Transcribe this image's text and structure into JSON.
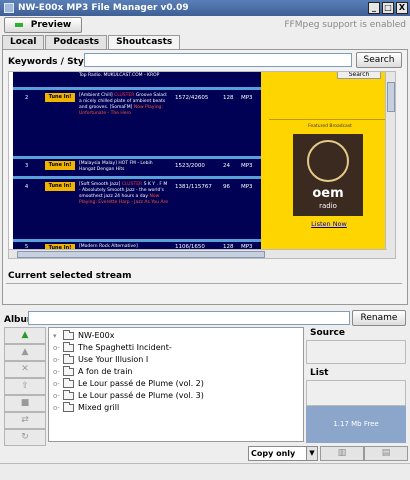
{
  "window": {
    "title": "NW-E00x MP3 File Manager v0.09",
    "controls": [
      "_",
      "□",
      "X"
    ]
  },
  "toolbar": {
    "preview_label": "Preview",
    "ffmpeg_status": "FFMpeg support is enabled"
  },
  "tabs": [
    {
      "label": "Local"
    },
    {
      "label": "Podcasts"
    },
    {
      "label": "Shoutcasts"
    }
  ],
  "search": {
    "label": "Keywords / Styles",
    "value": "",
    "button_label": "Search"
  },
  "web": {
    "streams": [
      {
        "num": "",
        "desc_white": "Top Radio. MUKULCAST.COM - KROP",
        "desc_pink": "",
        "now": "",
        "listeners": "",
        "bitrate": "",
        "type": ""
      },
      {
        "num": "2",
        "tune": "Tune In!",
        "desc_white": "[Ambient Chill]",
        "desc_pink": "CLUSTER",
        "desc_white2": "Groove Salad: a nicely chilled plate of ambient beats and grooves. [SomaFM]",
        "now": "Now Playing: Unfortunate - The Hero",
        "listeners": "1572/42605",
        "bitrate": "128",
        "type": "MP3"
      },
      {
        "num": "3",
        "tune": "Tune In!",
        "desc_white": "[Malaysia Malay] HOT FM - Lebih Hangat Dengan Hits",
        "desc_pink": "",
        "now": "",
        "listeners": "1523/2000",
        "bitrate": "24",
        "type": "MP3"
      },
      {
        "num": "4",
        "tune": "Tune In!",
        "desc_white": "[Soft Smooth Jazz]",
        "desc_pink": "CLUSTER",
        "desc_white2": "S K Y . F M - Absolutely Smooth Jazz - the world's smoothest jazz 24 hours a day",
        "now": "Now Playing: Everette Harp - Jazz As You Are",
        "listeners": "1381/115767",
        "bitrate": "96",
        "type": "MP3"
      },
      {
        "num": "5",
        "tune": "Tune In!",
        "desc_white": "[Modern Rock Alternative]",
        "desc_pink": "",
        "now": "",
        "listeners": "1106/1650",
        "bitrate": "128",
        "type": "MP3"
      }
    ],
    "ad": {
      "search_label": "Search",
      "featured": "Featured Broadcast",
      "logo_main": "oem",
      "logo_sub": "radio",
      "listen": "Listen Now"
    }
  },
  "current_stream_label": "Current selected stream",
  "album": {
    "label": "Album",
    "value": "",
    "rename_label": "Rename"
  },
  "tool_buttons": [
    "add-icon",
    "open-icon",
    "delete-icon",
    "up-arrow-icon",
    "stop-icon",
    "swap-icon",
    "refresh-icon"
  ],
  "tree": {
    "root": "NW-E00x",
    "items": [
      "The Spaghetti Incident-",
      "Use Your Illusion I",
      "A fon de train",
      "Le Lour passé de Plume (vol. 2)",
      "Le Lour passé de Plume (vol. 3)",
      "Mixed grill"
    ]
  },
  "side": {
    "source_label": "Source",
    "list_label": "List",
    "free_text": "1.17 Mb Free"
  },
  "bottom": {
    "copy_mode": "Copy only"
  },
  "colors": {
    "titlebar": "#3d5f96",
    "stream_bg": "#000055",
    "ad_bg": "#ffd500",
    "accent_pink": "#ff3b3b",
    "free_bg": "#8ca5cb"
  }
}
